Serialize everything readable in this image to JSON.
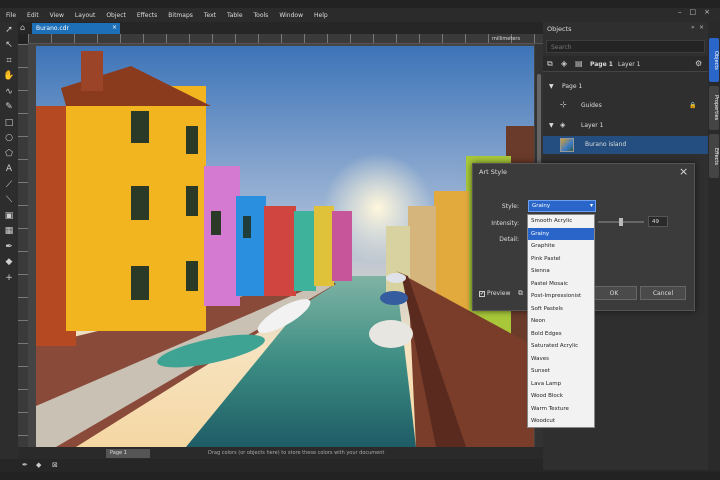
{
  "menu": [
    "File",
    "Edit",
    "View",
    "Layout",
    "Object",
    "Effects",
    "Bitmaps",
    "Text",
    "Table",
    "Tools",
    "Window",
    "Help"
  ],
  "document_tab": {
    "title": "Burano.cdr",
    "close": "×"
  },
  "window_controls": [
    "–",
    "□",
    "×"
  ],
  "ruler": {
    "unit_label": "millimeters"
  },
  "status": {
    "page_tab": "Page 1",
    "hint": "Drag colors (or objects here) to store these colors with your document"
  },
  "dock": {
    "title": "Objects",
    "search_placeholder": "Search",
    "toolbar": {
      "page_label": "Page 1",
      "layer_label": "Layer 1"
    },
    "tree": [
      {
        "label": "Page 1",
        "arrow": "▼"
      },
      {
        "label": "Guides",
        "arrow": ""
      },
      {
        "label": "Layer 1",
        "arrow": "▼"
      },
      {
        "label": "Burano island",
        "arrow": ""
      }
    ]
  },
  "side_tabs": [
    "Objects",
    "Properties",
    "Effects"
  ],
  "dialog": {
    "title": "Art Style",
    "close": "×",
    "style_label": "Style:",
    "style_value": "Grainy",
    "intensity_label": "Intensity:",
    "intensity_value": "49",
    "intensity_level": 0.49,
    "detail_label": "Detail:",
    "preview_label": "Preview",
    "preview_checked": "✔",
    "ok_label": "OK",
    "cancel_label": "Cancel"
  },
  "style_options": [
    "Smooth Acrylic",
    "Grainy",
    "Graphite",
    "Pink Pastel",
    "Sienna",
    "Pastel Mosaic",
    "Post-Impressionist",
    "Soft Pastels",
    "Neon",
    "Bold Edges",
    "Saturated Acrylic",
    "Waves",
    "Sunset",
    "Lava Lamp",
    "Wood Block",
    "Warm Texture",
    "Woodcut"
  ],
  "style_selected_index": 1,
  "colors": {
    "accent": "#1d6fb8",
    "selection": "#2a66c9",
    "tree_selected": "#234e7f"
  }
}
